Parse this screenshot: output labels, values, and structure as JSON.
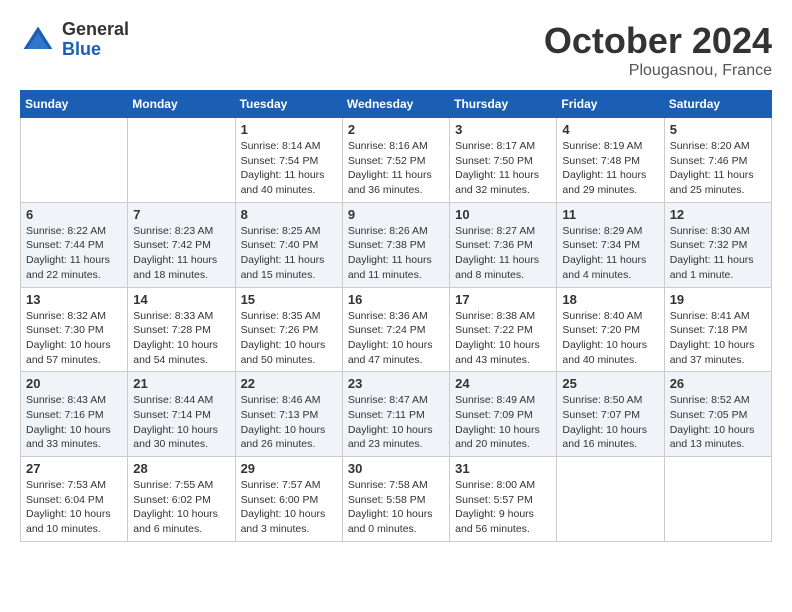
{
  "logo": {
    "general": "General",
    "blue": "Blue"
  },
  "title": "October 2024",
  "location": "Plougasnou, France",
  "days_of_week": [
    "Sunday",
    "Monday",
    "Tuesday",
    "Wednesday",
    "Thursday",
    "Friday",
    "Saturday"
  ],
  "weeks": [
    [
      {
        "day": "",
        "info": ""
      },
      {
        "day": "",
        "info": ""
      },
      {
        "day": "1",
        "info": "Sunrise: 8:14 AM\nSunset: 7:54 PM\nDaylight: 11 hours and 40 minutes."
      },
      {
        "day": "2",
        "info": "Sunrise: 8:16 AM\nSunset: 7:52 PM\nDaylight: 11 hours and 36 minutes."
      },
      {
        "day": "3",
        "info": "Sunrise: 8:17 AM\nSunset: 7:50 PM\nDaylight: 11 hours and 32 minutes."
      },
      {
        "day": "4",
        "info": "Sunrise: 8:19 AM\nSunset: 7:48 PM\nDaylight: 11 hours and 29 minutes."
      },
      {
        "day": "5",
        "info": "Sunrise: 8:20 AM\nSunset: 7:46 PM\nDaylight: 11 hours and 25 minutes."
      }
    ],
    [
      {
        "day": "6",
        "info": "Sunrise: 8:22 AM\nSunset: 7:44 PM\nDaylight: 11 hours and 22 minutes."
      },
      {
        "day": "7",
        "info": "Sunrise: 8:23 AM\nSunset: 7:42 PM\nDaylight: 11 hours and 18 minutes."
      },
      {
        "day": "8",
        "info": "Sunrise: 8:25 AM\nSunset: 7:40 PM\nDaylight: 11 hours and 15 minutes."
      },
      {
        "day": "9",
        "info": "Sunrise: 8:26 AM\nSunset: 7:38 PM\nDaylight: 11 hours and 11 minutes."
      },
      {
        "day": "10",
        "info": "Sunrise: 8:27 AM\nSunset: 7:36 PM\nDaylight: 11 hours and 8 minutes."
      },
      {
        "day": "11",
        "info": "Sunrise: 8:29 AM\nSunset: 7:34 PM\nDaylight: 11 hours and 4 minutes."
      },
      {
        "day": "12",
        "info": "Sunrise: 8:30 AM\nSunset: 7:32 PM\nDaylight: 11 hours and 1 minute."
      }
    ],
    [
      {
        "day": "13",
        "info": "Sunrise: 8:32 AM\nSunset: 7:30 PM\nDaylight: 10 hours and 57 minutes."
      },
      {
        "day": "14",
        "info": "Sunrise: 8:33 AM\nSunset: 7:28 PM\nDaylight: 10 hours and 54 minutes."
      },
      {
        "day": "15",
        "info": "Sunrise: 8:35 AM\nSunset: 7:26 PM\nDaylight: 10 hours and 50 minutes."
      },
      {
        "day": "16",
        "info": "Sunrise: 8:36 AM\nSunset: 7:24 PM\nDaylight: 10 hours and 47 minutes."
      },
      {
        "day": "17",
        "info": "Sunrise: 8:38 AM\nSunset: 7:22 PM\nDaylight: 10 hours and 43 minutes."
      },
      {
        "day": "18",
        "info": "Sunrise: 8:40 AM\nSunset: 7:20 PM\nDaylight: 10 hours and 40 minutes."
      },
      {
        "day": "19",
        "info": "Sunrise: 8:41 AM\nSunset: 7:18 PM\nDaylight: 10 hours and 37 minutes."
      }
    ],
    [
      {
        "day": "20",
        "info": "Sunrise: 8:43 AM\nSunset: 7:16 PM\nDaylight: 10 hours and 33 minutes."
      },
      {
        "day": "21",
        "info": "Sunrise: 8:44 AM\nSunset: 7:14 PM\nDaylight: 10 hours and 30 minutes."
      },
      {
        "day": "22",
        "info": "Sunrise: 8:46 AM\nSunset: 7:13 PM\nDaylight: 10 hours and 26 minutes."
      },
      {
        "day": "23",
        "info": "Sunrise: 8:47 AM\nSunset: 7:11 PM\nDaylight: 10 hours and 23 minutes."
      },
      {
        "day": "24",
        "info": "Sunrise: 8:49 AM\nSunset: 7:09 PM\nDaylight: 10 hours and 20 minutes."
      },
      {
        "day": "25",
        "info": "Sunrise: 8:50 AM\nSunset: 7:07 PM\nDaylight: 10 hours and 16 minutes."
      },
      {
        "day": "26",
        "info": "Sunrise: 8:52 AM\nSunset: 7:05 PM\nDaylight: 10 hours and 13 minutes."
      }
    ],
    [
      {
        "day": "27",
        "info": "Sunrise: 7:53 AM\nSunset: 6:04 PM\nDaylight: 10 hours and 10 minutes."
      },
      {
        "day": "28",
        "info": "Sunrise: 7:55 AM\nSunset: 6:02 PM\nDaylight: 10 hours and 6 minutes."
      },
      {
        "day": "29",
        "info": "Sunrise: 7:57 AM\nSunset: 6:00 PM\nDaylight: 10 hours and 3 minutes."
      },
      {
        "day": "30",
        "info": "Sunrise: 7:58 AM\nSunset: 5:58 PM\nDaylight: 10 hours and 0 minutes."
      },
      {
        "day": "31",
        "info": "Sunrise: 8:00 AM\nSunset: 5:57 PM\nDaylight: 9 hours and 56 minutes."
      },
      {
        "day": "",
        "info": ""
      },
      {
        "day": "",
        "info": ""
      }
    ]
  ]
}
